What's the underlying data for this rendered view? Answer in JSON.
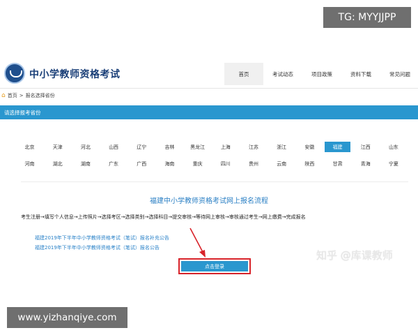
{
  "watermark_top": "TG: MYYJJPP",
  "watermark_bottom": "www.yizhanqiye.com",
  "watermark_zhihu": "知乎 @库课教师",
  "header": {
    "site_title": "中小学教师资格考试",
    "nav": [
      "首页",
      "考试动态",
      "项目政策",
      "资料下载",
      "常见问题"
    ]
  },
  "breadcrumb": {
    "home": "首页",
    "separator": ">",
    "current": "报名选择省份"
  },
  "section_bar": "请选择报考省份",
  "provinces": [
    "北京",
    "天津",
    "河北",
    "山西",
    "辽宁",
    "吉林",
    "黑龙江",
    "上海",
    "江苏",
    "浙江",
    "安徽",
    "福建",
    "江西",
    "山东",
    "河南",
    "湖北",
    "湖南",
    "广东",
    "广西",
    "海南",
    "重庆",
    "四川",
    "贵州",
    "云南",
    "陕西",
    "甘肃",
    "青海",
    "宁夏"
  ],
  "selected_province": "福建",
  "process": {
    "title": "福建中小学教师资格考试网上报名流程",
    "steps": "考生注册→填写个人信息→上传照片→选择考区→选择类别→选择科目→提交审核→等待网上审核→审核通过考生→网上缴费→完成报名",
    "notices": [
      "福建2019年下半年中小学教师资格考试（笔试）报名补充公告",
      "福建2019年下半年中小学教师资格考试（笔试）报名公告"
    ],
    "login_button": "点击登录"
  },
  "colors": {
    "accent": "#2a97cf",
    "highlight_border": "#d8232a",
    "title": "#1a3f78"
  }
}
